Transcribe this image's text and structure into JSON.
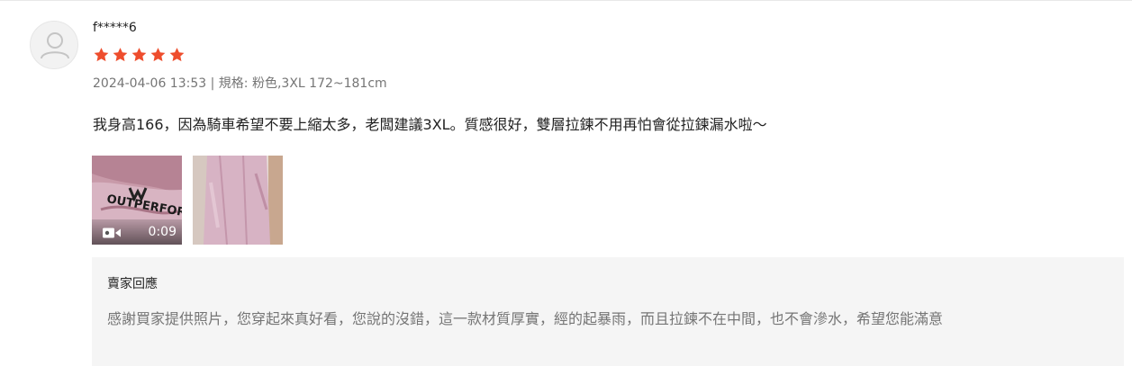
{
  "review": {
    "username": "f*****6",
    "rating": 5,
    "date": "2024-04-06 13:53",
    "separator": "|",
    "variation": "規格: 粉色,3XL 172~181cm",
    "text": "我身高166，因為騎車希望不要上縮太多，老闆建議3XL。質感很好，雙層拉鍊不用再怕會從拉鍊漏水啦～"
  },
  "media": {
    "video_duration": "0:09",
    "video_icon": "video-camera-icon",
    "image_text": "OUTPERFORM"
  },
  "seller_reply": {
    "title": "賣家回應",
    "text": "感謝買家提供照片，您穿起來真好看，您說的沒錯，這一款材質厚實，經的起暴雨，而且拉鍊不在中間，也不會滲水，希望您能滿意"
  },
  "colors": {
    "star": "#ee4d2d",
    "meta_text": "#757575",
    "reply_bg": "#f5f5f5",
    "product_pink": "#d9b3c4"
  }
}
